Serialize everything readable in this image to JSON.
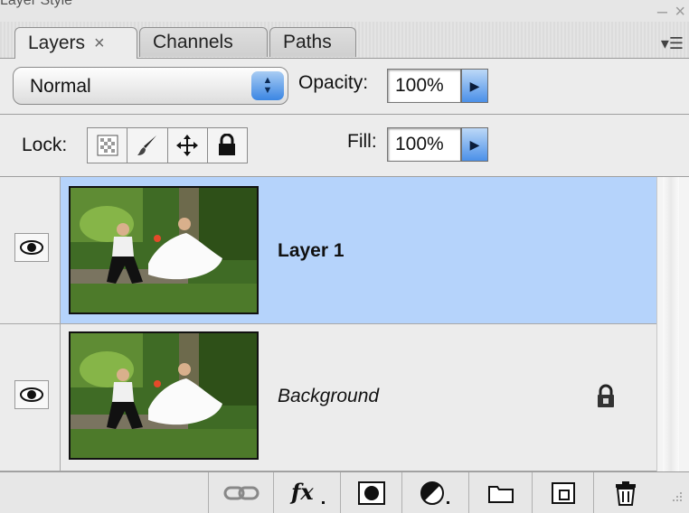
{
  "window": {
    "title_fragment": "Layer Style",
    "minimize_glyph": "–",
    "close_glyph": "×"
  },
  "tabs": [
    {
      "label": "Layers",
      "active": true,
      "close_glyph": "×"
    },
    {
      "label": "Channels",
      "active": false
    },
    {
      "label": "Paths",
      "active": false
    }
  ],
  "panel_menu_glyph": "▾☰",
  "blend": {
    "mode": "Normal"
  },
  "opacity": {
    "label": "Opacity:",
    "value": "100%"
  },
  "lock": {
    "label": "Lock:",
    "buttons": [
      "lock-transparent-icon",
      "lock-paint-brush-icon",
      "lock-move-icon",
      "lock-all-icon"
    ]
  },
  "fill": {
    "label": "Fill:",
    "value": "100%"
  },
  "layers": [
    {
      "name": "Layer 1",
      "selected": true,
      "visible": true,
      "locked": false
    },
    {
      "name": "Background",
      "selected": false,
      "visible": true,
      "locked": true
    }
  ],
  "colors": {
    "selection": "#b5d3fb",
    "accent_blue": "#3b86e3",
    "panel_bg": "#ececec"
  },
  "bottom_buttons": [
    "link-icon",
    "fx-icon",
    "mask-icon",
    "adjustment-icon",
    "folder-icon",
    "new-layer-icon",
    "trash-icon"
  ]
}
